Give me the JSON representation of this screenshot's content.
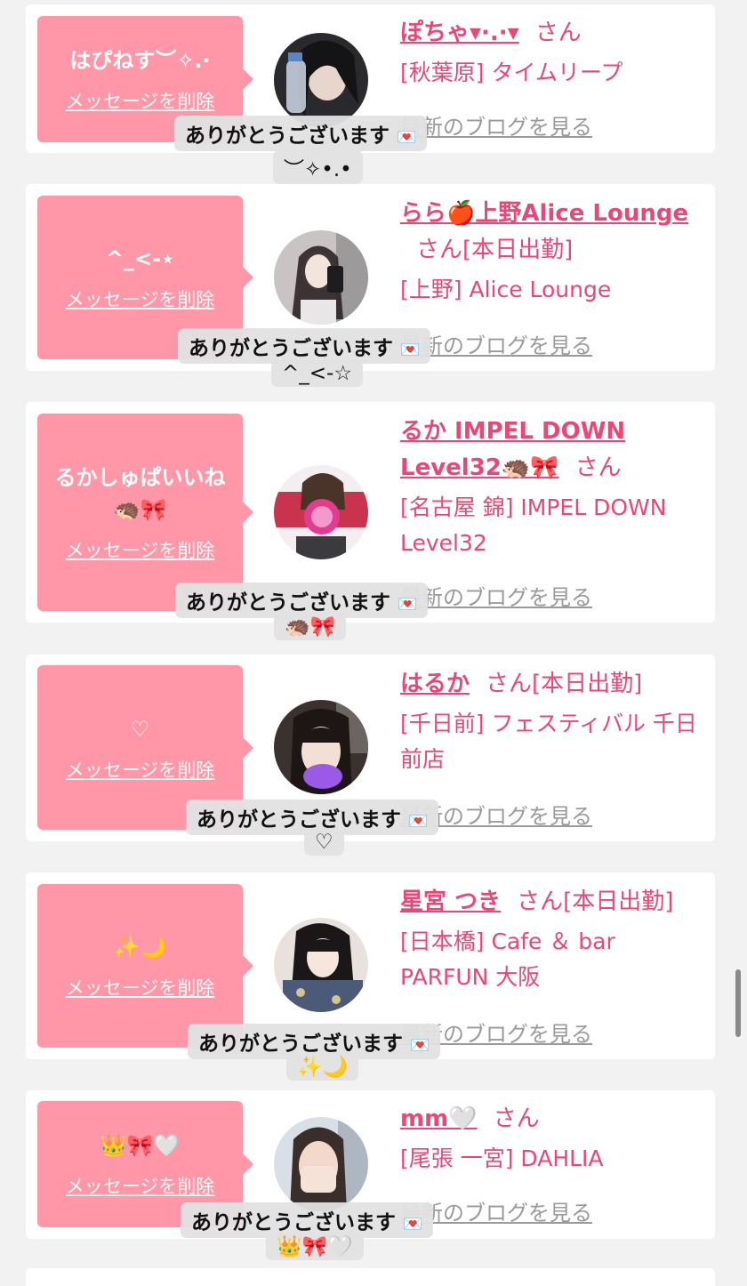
{
  "entries": [
    {
      "message": "はぴねす︶✧.·",
      "delete_label": "メッセージを削除",
      "name": "ぽちゃ▾·.·▾",
      "san": "さん",
      "status": "",
      "shop": "[秋葉原] タイムリープ",
      "blog_label": "最新のブログを見る",
      "toast_title": "ありがとうございます",
      "toast_body": "︶✧•.•",
      "avatar_icon": "photo-avatar"
    },
    {
      "message": "^_<-⋆",
      "delete_label": "メッセージを削除",
      "name": "らら🍎上野Alice Lounge",
      "san": "さん",
      "status": "[本日出勤]",
      "shop": "[上野] Alice Lounge",
      "blog_label": "最新のブログを見る",
      "toast_title": "ありがとうございます",
      "toast_body": "^_<-☆",
      "avatar_icon": "photo-avatar"
    },
    {
      "message": "るかしゅぱいいね🦔🎀",
      "delete_label": "メッセージを削除",
      "name": "るか IMPEL DOWN Level32🦔🎀",
      "san": "さん",
      "status": "",
      "shop": "[名古屋 錦] IMPEL DOWN Level32",
      "blog_label": "最新のブログを見る",
      "toast_title": "ありがとうございます",
      "toast_body": "🦔🎀",
      "avatar_icon": "photo-avatar"
    },
    {
      "message": "♡",
      "delete_label": "メッセージを削除",
      "name": "はるか",
      "san": "さん",
      "status": "[本日出勤]",
      "shop": "[千日前] フェスティバル 千日前店",
      "blog_label": "最新のブログを見る",
      "toast_title": "ありがとうございます",
      "toast_body": "♡",
      "avatar_icon": "photo-avatar"
    },
    {
      "message": "✨🌙",
      "delete_label": "メッセージを削除",
      "name": "星宮 つき",
      "san": "さん",
      "status": "[本日出勤]",
      "shop": "[日本橋] Cafe ＆ bar PARFUN 大阪",
      "blog_label": "最新のブログを見る",
      "toast_title": "ありがとうございます",
      "toast_body": "✨🌙",
      "avatar_icon": "photo-avatar"
    },
    {
      "message": "👑🎀🤍",
      "delete_label": "メッセージを削除",
      "name": "mm🤍",
      "san": "さん",
      "status": "",
      "shop": "[尾張 一宮] DAHLIA",
      "blog_label": "最新のブログを見る",
      "toast_title": "ありがとうございます",
      "toast_body": "👑🎀🤍",
      "avatar_icon": "photo-avatar"
    }
  ],
  "colors": {
    "accent_pink": "#e94877",
    "message_bg": "#ff97a8",
    "page_bg": "#f2f2f2",
    "envelope_heart": "#d81e3f"
  }
}
